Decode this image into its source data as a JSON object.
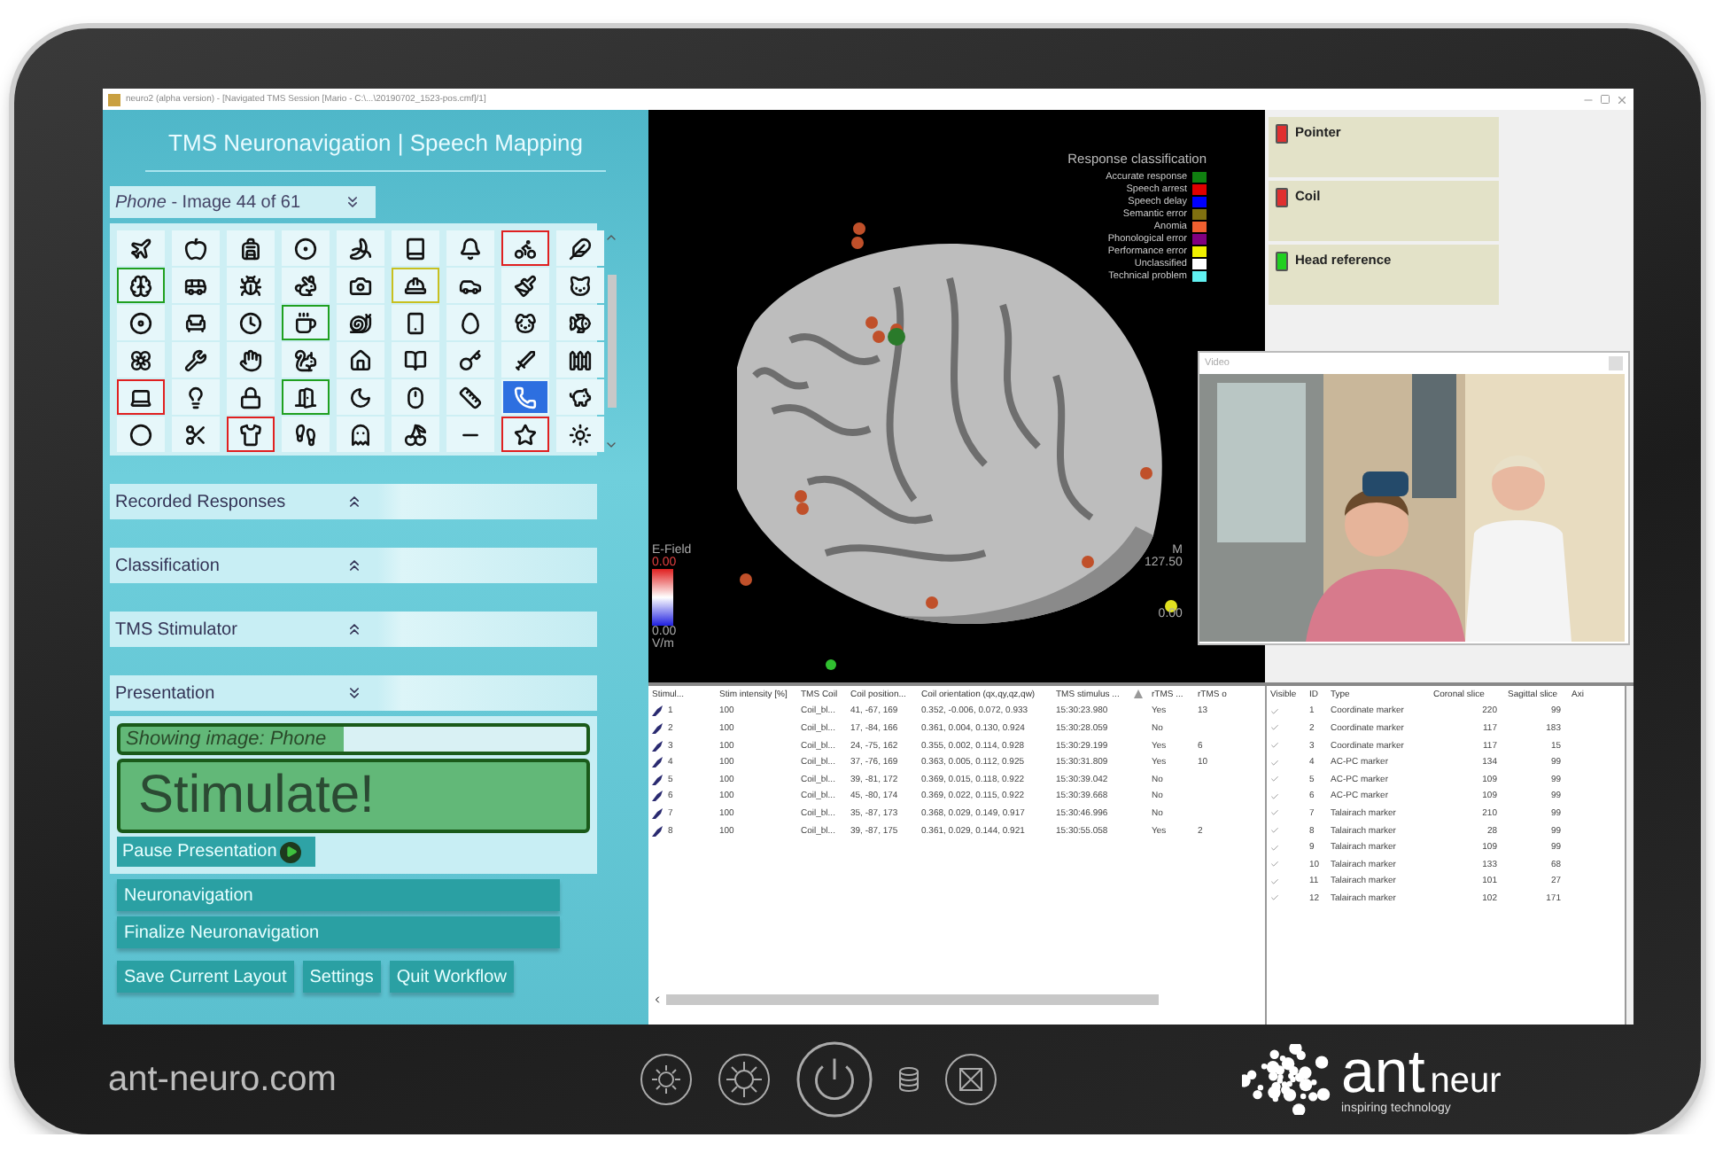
{
  "window": {
    "title": "neuro2 (alpha version) - [Navigated TMS Session [Mario - C:\\...\\20190702_1523-pos.cmf]/1]"
  },
  "left_panel": {
    "title": "TMS Neuronavigation | Speech Mapping",
    "image_section": {
      "label": "*Phone* - Image 44 of 61",
      "expanded": true,
      "pictures": [
        {
          "selected": false
        },
        {
          "selected": false
        },
        {
          "selected": false
        },
        {
          "selected": false
        },
        {
          "selected": false
        },
        {
          "selected": false
        },
        {
          "selected": false
        },
        {
          "selected": false,
          "color": "#e02020"
        },
        {
          "selected": false
        },
        {
          "selected": false,
          "color": "#20a020"
        },
        {
          "selected": false
        },
        {
          "selected": false
        },
        {
          "selected": false
        },
        {
          "selected": false
        },
        {
          "selected": false,
          "color": "#c8c020"
        },
        {
          "selected": false
        },
        {
          "selected": false
        },
        {
          "selected": false
        },
        {
          "selected": false
        },
        {
          "selected": false
        },
        {
          "selected": false
        },
        {
          "selected": false,
          "color": "#20a020"
        },
        {
          "selected": false
        },
        {
          "selected": false
        },
        {
          "selected": false
        },
        {
          "selected": false
        },
        {
          "selected": false
        },
        {
          "selected": false
        },
        {
          "selected": false
        },
        {
          "selected": false
        },
        {
          "selected": false
        },
        {
          "selected": false
        },
        {
          "selected": false
        },
        {
          "selected": false
        },
        {
          "selected": false
        },
        {
          "selected": false
        },
        {
          "selected": false,
          "color": "#e02020"
        },
        {
          "selected": false
        },
        {
          "selected": false
        },
        {
          "selected": false,
          "color": "#20a020"
        },
        {
          "selected": false
        },
        {
          "selected": false
        },
        {
          "selected": false
        },
        {
          "selected": true
        },
        {
          "selected": false
        },
        {
          "selected": false
        },
        {
          "selected": false
        },
        {
          "selected": false,
          "color": "#e02020"
        },
        {
          "selected": false
        },
        {
          "selected": false
        },
        {
          "selected": false
        },
        {
          "selected": false
        },
        {
          "selected": false,
          "color": "#e02020"
        },
        {
          "selected": false
        }
      ]
    },
    "sections": [
      {
        "label": "Recorded Responses",
        "expanded": false
      },
      {
        "label": "Classification",
        "expanded": false
      },
      {
        "label": "TMS Stimulator",
        "expanded": false
      },
      {
        "label": "Presentation",
        "expanded": true
      }
    ],
    "presentation": {
      "showing": "Showing image: Phone",
      "stimulate": "Stimulate!",
      "pause": "Pause Presentation"
    },
    "buttons": [
      {
        "label": "Neuronavigation",
        "kind": "wide"
      },
      {
        "label": "Finalize Neuronavigation",
        "kind": "wide"
      },
      {
        "label": "Save Current Layout",
        "kind": "small"
      },
      {
        "label": "Settings",
        "kind": "small"
      },
      {
        "label": "Quit Workflow",
        "kind": "small"
      }
    ]
  },
  "view_3d": {
    "legend_title": "Response classification",
    "legend": [
      {
        "label": "Accurate response",
        "color": "#108010"
      },
      {
        "label": "Speech arrest",
        "color": "#e00000"
      },
      {
        "label": "Speech delay",
        "color": "#0000ff"
      },
      {
        "label": "Semantic error",
        "color": "#807010"
      },
      {
        "label": "Anomia",
        "color": "#f06030"
      },
      {
        "label": "Phonological error",
        "color": "#800080"
      },
      {
        "label": "Performance error",
        "color": "#f0f000"
      },
      {
        "label": "Unclassified",
        "color": "#ffffff"
      },
      {
        "label": "Technical problem",
        "color": "#60f0f0"
      }
    ],
    "scale_left": {
      "title": "E-Field",
      "max": "0.00",
      "min": "0.00",
      "unit": "V/m"
    },
    "scale_right": {
      "title": "M",
      "max": "127.50",
      "min": "0.00"
    }
  },
  "trackers": [
    {
      "label": "Pointer",
      "color": "#e03030"
    },
    {
      "label": "Coil",
      "color": "#e03030"
    },
    {
      "label": "Head reference",
      "color": "#20d020"
    }
  ],
  "video": {
    "title": "Video"
  },
  "stimuli_table": {
    "columns": [
      "Stimul...",
      "Stim intensity [%]",
      "TMS Coil",
      "Coil position...",
      "Coil orientation (qx,qy,qz,qw)",
      "TMS stimulus ...",
      "rTMS ...",
      "rTMS o"
    ],
    "rows": [
      [
        "1",
        "100",
        "Coil_bl...",
        "41, -67, 169",
        "0.352, -0.006, 0.072, 0.933",
        "15:30:23.980",
        "Yes",
        "13"
      ],
      [
        "2",
        "100",
        "Coil_bl...",
        "17, -84, 166",
        "0.361, 0.004, 0.130, 0.924",
        "15:30:28.059",
        "No",
        ""
      ],
      [
        "3",
        "100",
        "Coil_bl...",
        "24, -75, 162",
        "0.355, 0.002, 0.114, 0.928",
        "15:30:29.199",
        "Yes",
        "6"
      ],
      [
        "4",
        "100",
        "Coil_bl...",
        "37, -76, 169",
        "0.363, 0.005, 0.112, 0.925",
        "15:30:31.809",
        "Yes",
        "10"
      ],
      [
        "5",
        "100",
        "Coil_bl...",
        "39, -81, 172",
        "0.369, 0.015, 0.118, 0.922",
        "15:30:39.042",
        "No",
        ""
      ],
      [
        "6",
        "100",
        "Coil_bl...",
        "45, -80, 174",
        "0.369, 0.022, 0.115, 0.922",
        "15:30:39.668",
        "No",
        ""
      ],
      [
        "7",
        "100",
        "Coil_bl...",
        "35, -87, 173",
        "0.368, 0.029, 0.149, 0.917",
        "15:30:46.996",
        "No",
        ""
      ],
      [
        "8",
        "100",
        "Coil_bl...",
        "39, -87, 175",
        "0.361, 0.029, 0.144, 0.921",
        "15:30:55.058",
        "Yes",
        "2"
      ]
    ]
  },
  "markers_table": {
    "visible_header": "Visible",
    "columns": [
      "ID",
      "Type",
      "Coronal slice",
      "Sagittal slice",
      "Axi"
    ],
    "rows": [
      {
        "visible": true,
        "cells": [
          "1",
          "Coordinate marker",
          "220",
          "99"
        ]
      },
      {
        "visible": true,
        "cells": [
          "2",
          "Coordinate marker",
          "117",
          "183"
        ]
      },
      {
        "visible": true,
        "cells": [
          "3",
          "Coordinate marker",
          "117",
          "15"
        ]
      },
      {
        "visible": true,
        "cells": [
          "4",
          "AC-PC marker",
          "134",
          "99"
        ]
      },
      {
        "visible": true,
        "cells": [
          "5",
          "AC-PC marker",
          "109",
          "99"
        ]
      },
      {
        "visible": true,
        "cells": [
          "6",
          "AC-PC marker",
          "109",
          "99"
        ]
      },
      {
        "visible": true,
        "cells": [
          "7",
          "Talairach marker",
          "210",
          "99"
        ]
      },
      {
        "visible": true,
        "cells": [
          "8",
          "Talairach marker",
          "28",
          "99"
        ]
      },
      {
        "visible": true,
        "cells": [
          "9",
          "Talairach marker",
          "109",
          "99"
        ]
      },
      {
        "visible": true,
        "cells": [
          "10",
          "Talairach marker",
          "133",
          "68"
        ]
      },
      {
        "visible": true,
        "cells": [
          "11",
          "Talairach marker",
          "101",
          "27"
        ]
      },
      {
        "visible": true,
        "cells": [
          "12",
          "Talairach marker",
          "102",
          "171"
        ]
      }
    ]
  },
  "device": {
    "website": "ant-neuro.com",
    "brand": "ant",
    "brand_2": "neur",
    "tagline": "inspiring technology"
  }
}
